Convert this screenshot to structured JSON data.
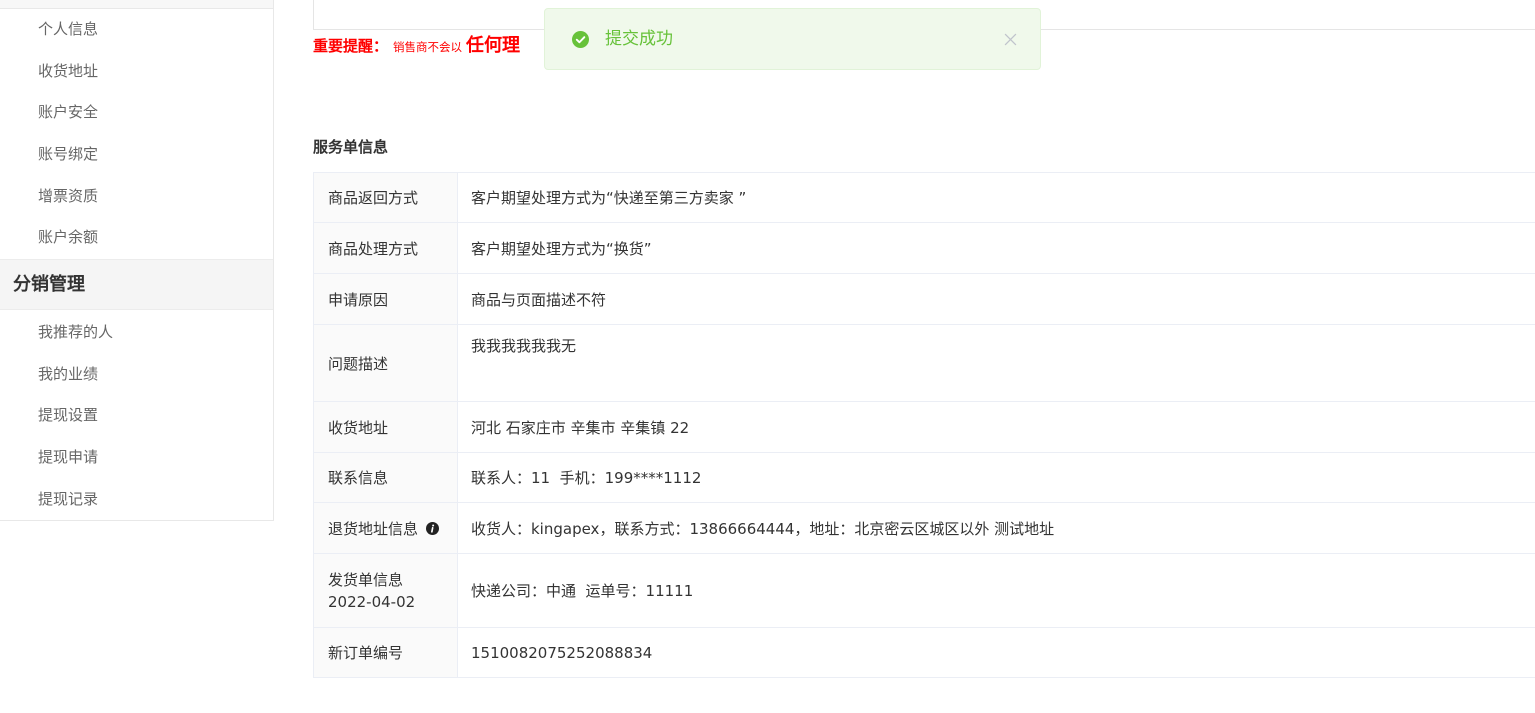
{
  "sidebar": {
    "account_items": [
      "个人信息",
      "收货地址",
      "账户安全",
      "账号绑定",
      "增票资质",
      "账户余额"
    ],
    "distribution_title": "分销管理",
    "distribution_items": [
      "我推荐的人",
      "我的业绩",
      "提现设置",
      "提现申请",
      "提现记录"
    ]
  },
  "notice": {
    "label": "重要提醒：",
    "text": "销售商不会以",
    "emphasis": "任何理"
  },
  "toast": {
    "message": "提交成功",
    "icon": "check-circle-icon",
    "close_icon": "close-icon",
    "color": "#67c23a",
    "background": "#f0f9eb"
  },
  "service_order": {
    "title": "服务单信息",
    "rows": [
      {
        "label": "商品返回方式",
        "value": "客户期望处理方式为“快递至第三方卖家 ”"
      },
      {
        "label": "商品处理方式",
        "value": "客户期望处理方式为“换货”"
      },
      {
        "label": "申请原因",
        "value": "商品与页面描述不符"
      },
      {
        "label": "问题描述",
        "value": "我我我我我我无"
      },
      {
        "label": "收货地址",
        "value": "河北 石家庄市 辛集市 辛集镇 22"
      },
      {
        "label": "联系信息",
        "value": "联系人：11  手机：199****1112"
      },
      {
        "label": "退货地址信息",
        "icon": "info-icon",
        "value": "收货人：kingapex，联系方式：13866664444，地址：北京密云区城区以外 测试地址"
      },
      {
        "label": "发货单信息",
        "sublabel": "2022-04-02",
        "value": "快递公司：中通  运单号：11111"
      },
      {
        "label": "新订单编号",
        "value": "1510082075252088834"
      }
    ]
  },
  "colors": {
    "notice_red": "#ff0000",
    "success_green": "#67c23a",
    "border": "#ebeef5"
  }
}
